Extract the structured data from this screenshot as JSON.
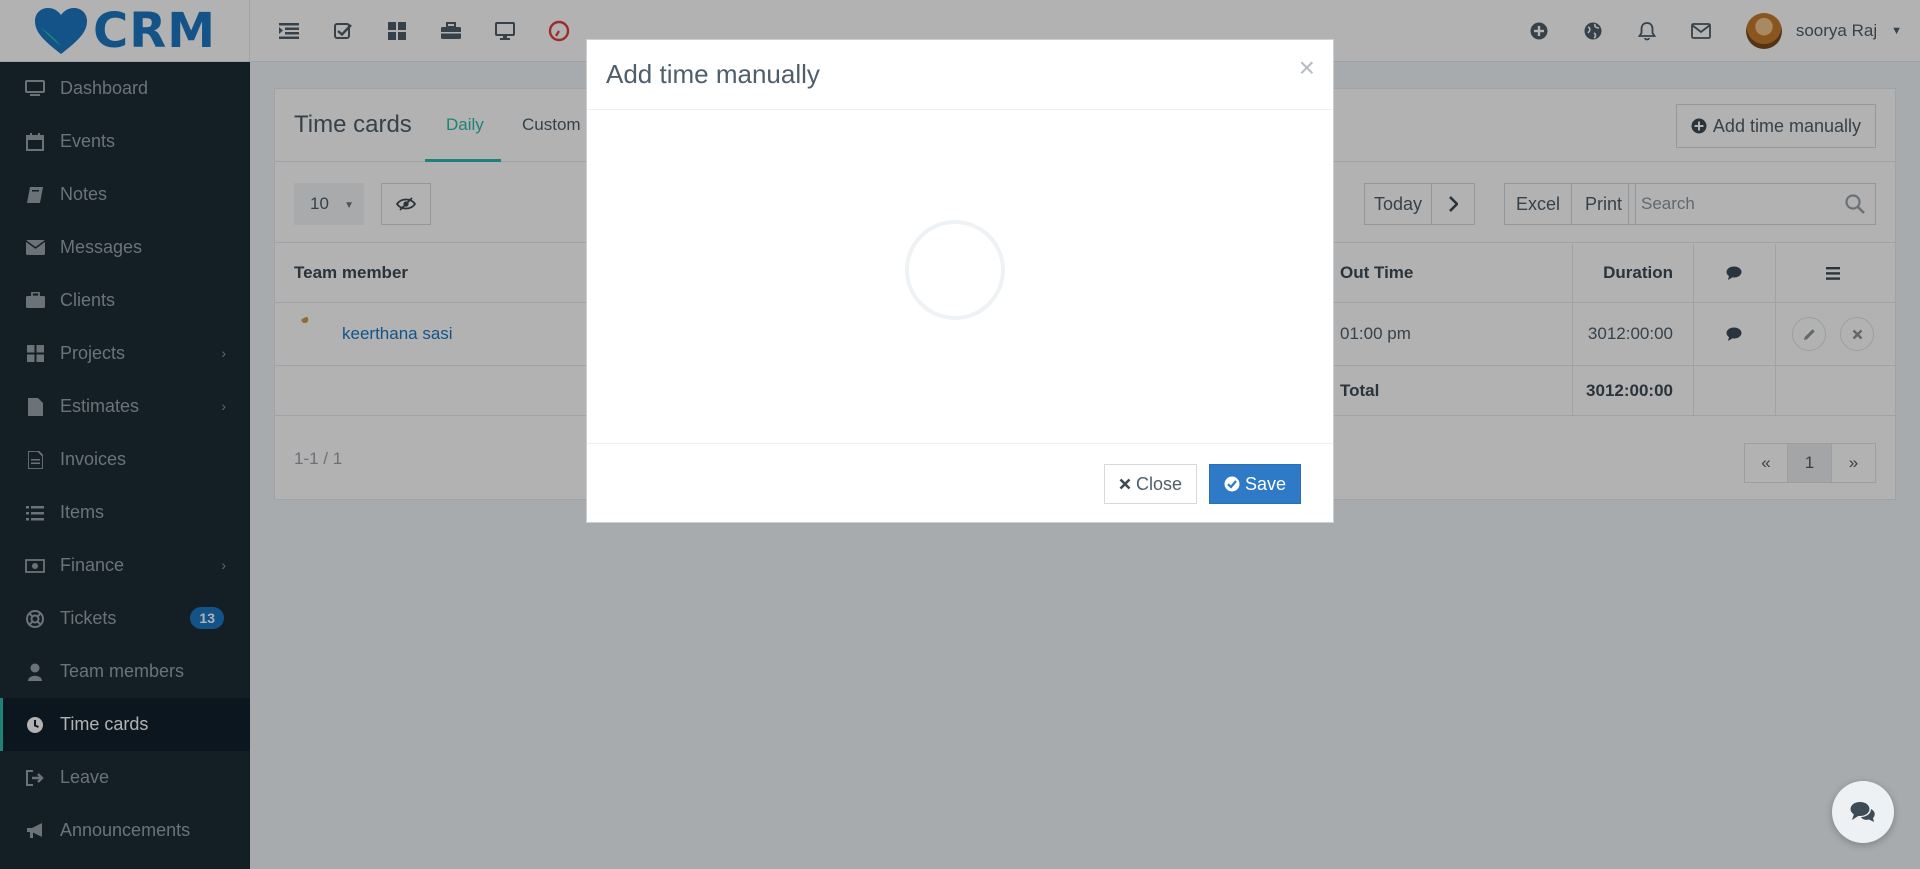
{
  "app": {
    "brand": "CRM",
    "brand_color": "#1d78c3",
    "accent_color": "#2bbbad"
  },
  "topbar": {
    "left_icons": [
      "list-icon",
      "check-icon",
      "grid-icon",
      "briefcase-icon",
      "desktop-icon",
      "clock-red-icon"
    ],
    "right_icons": [
      "plus-circle-icon",
      "globe-icon",
      "bell-icon",
      "envelope-icon"
    ],
    "user_name": "soorya Raj"
  },
  "sidebar": {
    "items": [
      {
        "label": "Dashboard",
        "icon": "desktop-icon"
      },
      {
        "label": "Events",
        "icon": "calendar-icon"
      },
      {
        "label": "Notes",
        "icon": "book-icon"
      },
      {
        "label": "Messages",
        "icon": "envelope-icon"
      },
      {
        "label": "Clients",
        "icon": "briefcase-icon"
      },
      {
        "label": "Projects",
        "icon": "grid-icon",
        "chevron": "›"
      },
      {
        "label": "Estimates",
        "icon": "file-icon",
        "chevron": "›"
      },
      {
        "label": "Invoices",
        "icon": "file-text-icon"
      },
      {
        "label": "Items",
        "icon": "list-icon"
      },
      {
        "label": "Finance",
        "icon": "money-icon",
        "chevron": "›"
      },
      {
        "label": "Tickets",
        "icon": "life-ring-icon",
        "badge": "13"
      },
      {
        "label": "Team members",
        "icon": "user-icon"
      },
      {
        "label": "Time cards",
        "icon": "clock-icon",
        "active": true
      },
      {
        "label": "Leave",
        "icon": "sign-out-icon"
      },
      {
        "label": "Announcements",
        "icon": "bullhorn-icon"
      }
    ]
  },
  "card": {
    "title": "Time cards",
    "tabs": [
      "Daily",
      "Custom"
    ],
    "active_tab": "Daily",
    "add_button": "Add time manually",
    "page_size": "10",
    "today_button": "Today",
    "excel_button": "Excel",
    "print_button": "Print",
    "search_placeholder": "Search",
    "columns": {
      "member": "Team member",
      "out_time": "Out Time",
      "duration": "Duration"
    },
    "rows": [
      {
        "member": "keerthana sasi",
        "out_time": "01:00 pm",
        "duration": "3012:00:00"
      }
    ],
    "footer": {
      "total_label": "Total",
      "total_duration": "3012:00:00"
    },
    "range": "1-1 / 1",
    "pager": [
      "«",
      "1",
      "»"
    ]
  },
  "modal": {
    "title": "Add time manually",
    "close_symbol": "×",
    "close_button": "Close",
    "save_button": "Save"
  }
}
